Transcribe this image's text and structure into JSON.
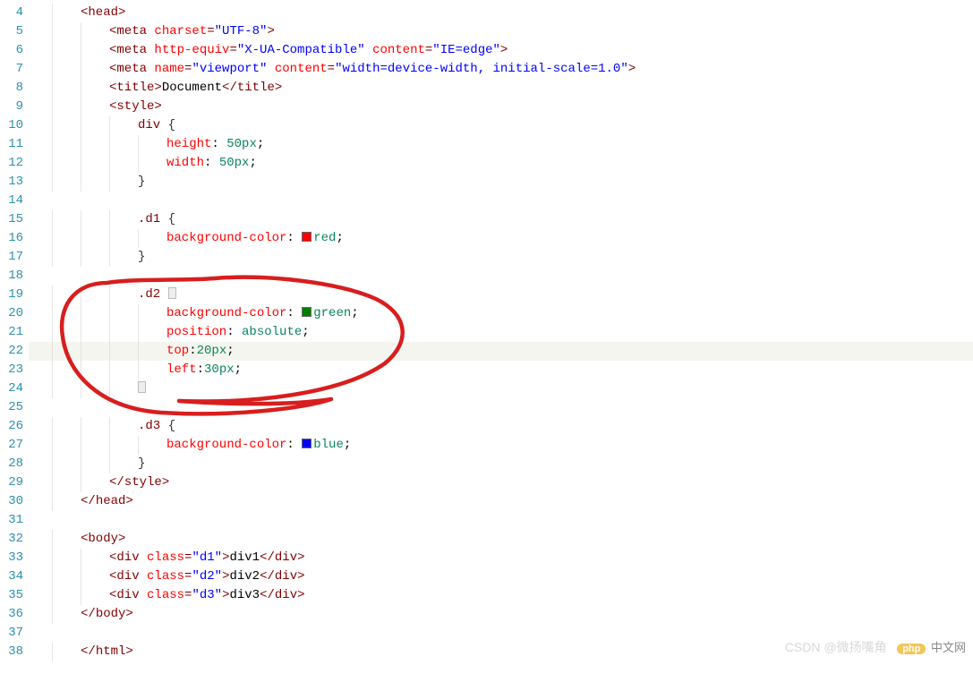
{
  "lines": [
    {
      "n": 4,
      "indent": 1,
      "segs": [
        {
          "t": "<",
          "c": "punct"
        },
        {
          "t": "head",
          "c": "tag"
        },
        {
          "t": ">",
          "c": "punct"
        }
      ]
    },
    {
      "n": 5,
      "indent": 2,
      "segs": [
        {
          "t": "<",
          "c": "punct"
        },
        {
          "t": "meta",
          "c": "tag"
        },
        {
          "t": " ",
          "c": "txt"
        },
        {
          "t": "charset",
          "c": "attr-name"
        },
        {
          "t": "=",
          "c": "punct"
        },
        {
          "t": "\"UTF-8\"",
          "c": "attr-val"
        },
        {
          "t": ">",
          "c": "punct"
        }
      ]
    },
    {
      "n": 6,
      "indent": 2,
      "segs": [
        {
          "t": "<",
          "c": "punct"
        },
        {
          "t": "meta",
          "c": "tag"
        },
        {
          "t": " ",
          "c": "txt"
        },
        {
          "t": "http-equiv",
          "c": "attr-name"
        },
        {
          "t": "=",
          "c": "punct"
        },
        {
          "t": "\"X-UA-Compatible\"",
          "c": "attr-val"
        },
        {
          "t": " ",
          "c": "txt"
        },
        {
          "t": "content",
          "c": "attr-name"
        },
        {
          "t": "=",
          "c": "punct"
        },
        {
          "t": "\"IE=edge\"",
          "c": "attr-val"
        },
        {
          "t": ">",
          "c": "punct"
        }
      ]
    },
    {
      "n": 7,
      "indent": 2,
      "segs": [
        {
          "t": "<",
          "c": "punct"
        },
        {
          "t": "meta",
          "c": "tag"
        },
        {
          "t": " ",
          "c": "txt"
        },
        {
          "t": "name",
          "c": "attr-name"
        },
        {
          "t": "=",
          "c": "punct"
        },
        {
          "t": "\"viewport\"",
          "c": "attr-val"
        },
        {
          "t": " ",
          "c": "txt"
        },
        {
          "t": "content",
          "c": "attr-name"
        },
        {
          "t": "=",
          "c": "punct"
        },
        {
          "t": "\"width=device-width, initial-scale=1.0\"",
          "c": "attr-val"
        },
        {
          "t": ">",
          "c": "punct"
        }
      ]
    },
    {
      "n": 8,
      "indent": 2,
      "segs": [
        {
          "t": "<",
          "c": "punct"
        },
        {
          "t": "title",
          "c": "tag"
        },
        {
          "t": ">",
          "c": "punct"
        },
        {
          "t": "Document",
          "c": "txt"
        },
        {
          "t": "</",
          "c": "punct"
        },
        {
          "t": "title",
          "c": "tag"
        },
        {
          "t": ">",
          "c": "punct"
        }
      ]
    },
    {
      "n": 9,
      "indent": 2,
      "segs": [
        {
          "t": "<",
          "c": "punct"
        },
        {
          "t": "style",
          "c": "tag"
        },
        {
          "t": ">",
          "c": "punct"
        }
      ]
    },
    {
      "n": 10,
      "indent": 3,
      "segs": [
        {
          "t": "div",
          "c": "selector"
        },
        {
          "t": " ",
          "c": "txt"
        },
        {
          "t": "{",
          "c": "brace"
        }
      ]
    },
    {
      "n": 11,
      "indent": 4,
      "segs": [
        {
          "t": "height",
          "c": "prop"
        },
        {
          "t": ": ",
          "c": "txt"
        },
        {
          "t": "50px",
          "c": "num"
        },
        {
          "t": ";",
          "c": "txt"
        }
      ]
    },
    {
      "n": 12,
      "indent": 4,
      "segs": [
        {
          "t": "width",
          "c": "prop"
        },
        {
          "t": ": ",
          "c": "txt"
        },
        {
          "t": "50px",
          "c": "num"
        },
        {
          "t": ";",
          "c": "txt"
        }
      ]
    },
    {
      "n": 13,
      "indent": 3,
      "segs": [
        {
          "t": "}",
          "c": "brace"
        }
      ]
    },
    {
      "n": 14,
      "indent": 0,
      "segs": []
    },
    {
      "n": 15,
      "indent": 3,
      "segs": [
        {
          "t": ".d1",
          "c": "selector"
        },
        {
          "t": " ",
          "c": "txt"
        },
        {
          "t": "{",
          "c": "brace"
        }
      ]
    },
    {
      "n": 16,
      "indent": 4,
      "segs": [
        {
          "t": "background-color",
          "c": "prop"
        },
        {
          "t": ": ",
          "c": "txt"
        },
        {
          "swatch": "#ff0000"
        },
        {
          "t": "red",
          "c": "num"
        },
        {
          "t": ";",
          "c": "txt"
        }
      ]
    },
    {
      "n": 17,
      "indent": 3,
      "segs": [
        {
          "t": "}",
          "c": "brace"
        }
      ]
    },
    {
      "n": 18,
      "indent": 0,
      "segs": []
    },
    {
      "n": 19,
      "indent": 3,
      "segs": [
        {
          "t": ".d2",
          "c": "selector"
        },
        {
          "t": " ",
          "c": "txt"
        },
        {
          "fold": true
        }
      ]
    },
    {
      "n": 20,
      "indent": 4,
      "segs": [
        {
          "t": "background-color",
          "c": "prop"
        },
        {
          "t": ": ",
          "c": "txt"
        },
        {
          "swatch": "#008000"
        },
        {
          "t": "green",
          "c": "num"
        },
        {
          "t": ";",
          "c": "txt"
        }
      ]
    },
    {
      "n": 21,
      "indent": 4,
      "segs": [
        {
          "t": "position",
          "c": "prop"
        },
        {
          "t": ": ",
          "c": "txt"
        },
        {
          "t": "absolute",
          "c": "num"
        },
        {
          "t": ";",
          "c": "txt"
        }
      ]
    },
    {
      "n": 22,
      "indent": 4,
      "hl": true,
      "segs": [
        {
          "t": "top",
          "c": "prop"
        },
        {
          "t": ":",
          "c": "txt"
        },
        {
          "t": "20px",
          "c": "num"
        },
        {
          "t": ";",
          "c": "txt"
        }
      ]
    },
    {
      "n": 23,
      "indent": 4,
      "segs": [
        {
          "t": "left",
          "c": "prop"
        },
        {
          "t": ":",
          "c": "txt"
        },
        {
          "t": "30px",
          "c": "num"
        },
        {
          "t": ";",
          "c": "txt"
        }
      ]
    },
    {
      "n": 24,
      "indent": 3,
      "segs": [
        {
          "fold": true
        }
      ]
    },
    {
      "n": 25,
      "indent": 0,
      "segs": []
    },
    {
      "n": 26,
      "indent": 3,
      "segs": [
        {
          "t": ".d3",
          "c": "selector"
        },
        {
          "t": " ",
          "c": "txt"
        },
        {
          "t": "{",
          "c": "brace"
        }
      ]
    },
    {
      "n": 27,
      "indent": 4,
      "segs": [
        {
          "t": "background-color",
          "c": "prop"
        },
        {
          "t": ": ",
          "c": "txt"
        },
        {
          "swatch": "#0000ff"
        },
        {
          "t": "blue",
          "c": "num"
        },
        {
          "t": ";",
          "c": "txt"
        }
      ]
    },
    {
      "n": 28,
      "indent": 3,
      "segs": [
        {
          "t": "}",
          "c": "brace"
        }
      ]
    },
    {
      "n": 29,
      "indent": 2,
      "segs": [
        {
          "t": "</",
          "c": "punct"
        },
        {
          "t": "style",
          "c": "tag"
        },
        {
          "t": ">",
          "c": "punct"
        }
      ]
    },
    {
      "n": 30,
      "indent": 1,
      "segs": [
        {
          "t": "</",
          "c": "punct"
        },
        {
          "t": "head",
          "c": "tag"
        },
        {
          "t": ">",
          "c": "punct"
        }
      ]
    },
    {
      "n": 31,
      "indent": 0,
      "segs": []
    },
    {
      "n": 32,
      "indent": 1,
      "segs": [
        {
          "t": "<",
          "c": "punct"
        },
        {
          "t": "body",
          "c": "tag"
        },
        {
          "t": ">",
          "c": "punct"
        }
      ]
    },
    {
      "n": 33,
      "indent": 2,
      "segs": [
        {
          "t": "<",
          "c": "punct"
        },
        {
          "t": "div",
          "c": "tag"
        },
        {
          "t": " ",
          "c": "txt"
        },
        {
          "t": "class",
          "c": "attr-name"
        },
        {
          "t": "=",
          "c": "punct"
        },
        {
          "t": "\"d1\"",
          "c": "attr-val"
        },
        {
          "t": ">",
          "c": "punct"
        },
        {
          "t": "div1",
          "c": "txt"
        },
        {
          "t": "</",
          "c": "punct"
        },
        {
          "t": "div",
          "c": "tag"
        },
        {
          "t": ">",
          "c": "punct"
        }
      ]
    },
    {
      "n": 34,
      "indent": 2,
      "segs": [
        {
          "t": "<",
          "c": "punct"
        },
        {
          "t": "div",
          "c": "tag"
        },
        {
          "t": " ",
          "c": "txt"
        },
        {
          "t": "class",
          "c": "attr-name"
        },
        {
          "t": "=",
          "c": "punct"
        },
        {
          "t": "\"d2\"",
          "c": "attr-val"
        },
        {
          "t": ">",
          "c": "punct"
        },
        {
          "t": "div2",
          "c": "txt"
        },
        {
          "t": "</",
          "c": "punct"
        },
        {
          "t": "div",
          "c": "tag"
        },
        {
          "t": ">",
          "c": "punct"
        }
      ]
    },
    {
      "n": 35,
      "indent": 2,
      "segs": [
        {
          "t": "<",
          "c": "punct"
        },
        {
          "t": "div",
          "c": "tag"
        },
        {
          "t": " ",
          "c": "txt"
        },
        {
          "t": "class",
          "c": "attr-name"
        },
        {
          "t": "=",
          "c": "punct"
        },
        {
          "t": "\"d3\"",
          "c": "attr-val"
        },
        {
          "t": ">",
          "c": "punct"
        },
        {
          "t": "div3",
          "c": "txt"
        },
        {
          "t": "</",
          "c": "punct"
        },
        {
          "t": "div",
          "c": "tag"
        },
        {
          "t": ">",
          "c": "punct"
        }
      ]
    },
    {
      "n": 36,
      "indent": 1,
      "segs": [
        {
          "t": "</",
          "c": "punct"
        },
        {
          "t": "body",
          "c": "tag"
        },
        {
          "t": ">",
          "c": "punct"
        }
      ]
    },
    {
      "n": 37,
      "indent": 0,
      "segs": []
    },
    {
      "n": 38,
      "indent": 1,
      "segs": [
        {
          "t": "</",
          "c": "punct"
        },
        {
          "t": "html",
          "c": "tag"
        },
        {
          "t": ">",
          "c": "punct"
        }
      ]
    }
  ],
  "watermark": {
    "php_label": "php",
    "cn_text": "中文网",
    "csdn_text": "CSDN @微扬嘴角"
  }
}
